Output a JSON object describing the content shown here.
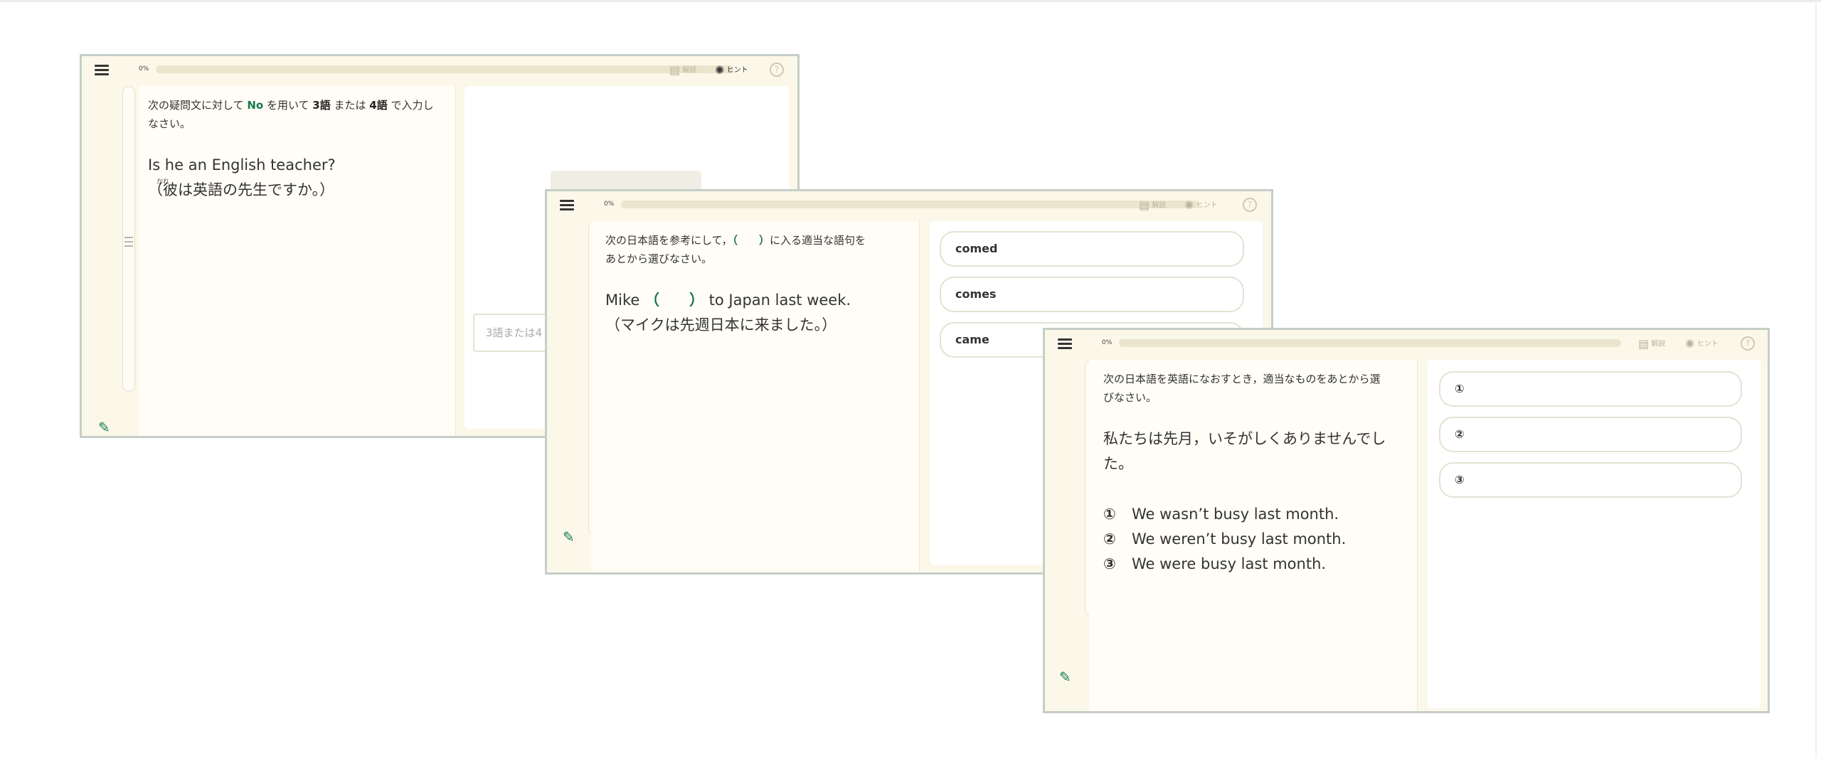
{
  "common": {
    "progress_label": "0%",
    "explanation_label": "解説",
    "hint_label": "ヒント",
    "help_label": "?"
  },
  "window1": {
    "instruction_parts": [
      "次の疑問文に対して ",
      "No",
      " を用いて ",
      "3語",
      " または ",
      "4語",
      " で入力し",
      "なさい。"
    ],
    "question_line1": "Is he an English teacher?",
    "question_line2": "（彼は英語の先生ですか。）",
    "ruby": "かれ",
    "input_placeholder": "3語または4"
  },
  "window2": {
    "instruction_line1_before": "次の日本語を参考にして，",
    "instruction_paren": "（　　）",
    "instruction_line1_after": "に入る適当な語句を",
    "instruction_line2": "あとから選びなさい。",
    "question_before": "Mike ",
    "question_paren": "（　　）",
    "question_after": " to Japan last week.",
    "question_line2": "（マイクは先週日本に来ました。）",
    "choices": [
      "comed",
      "comes",
      "came"
    ]
  },
  "window3": {
    "instruction_line1": "次の日本語を英語になおすとき，適当なものをあとから選",
    "instruction_line2": "びなさい。",
    "question_line1": "私たちは先月，いそがしくありませんでし",
    "question_line2": "た。",
    "options": [
      {
        "num": "①",
        "text": "We wasn’t busy last month."
      },
      {
        "num": "②",
        "text": "We weren’t busy last month."
      },
      {
        "num": "③",
        "text": "We were busy last month."
      }
    ],
    "choices": [
      "①",
      "②",
      "③"
    ]
  }
}
